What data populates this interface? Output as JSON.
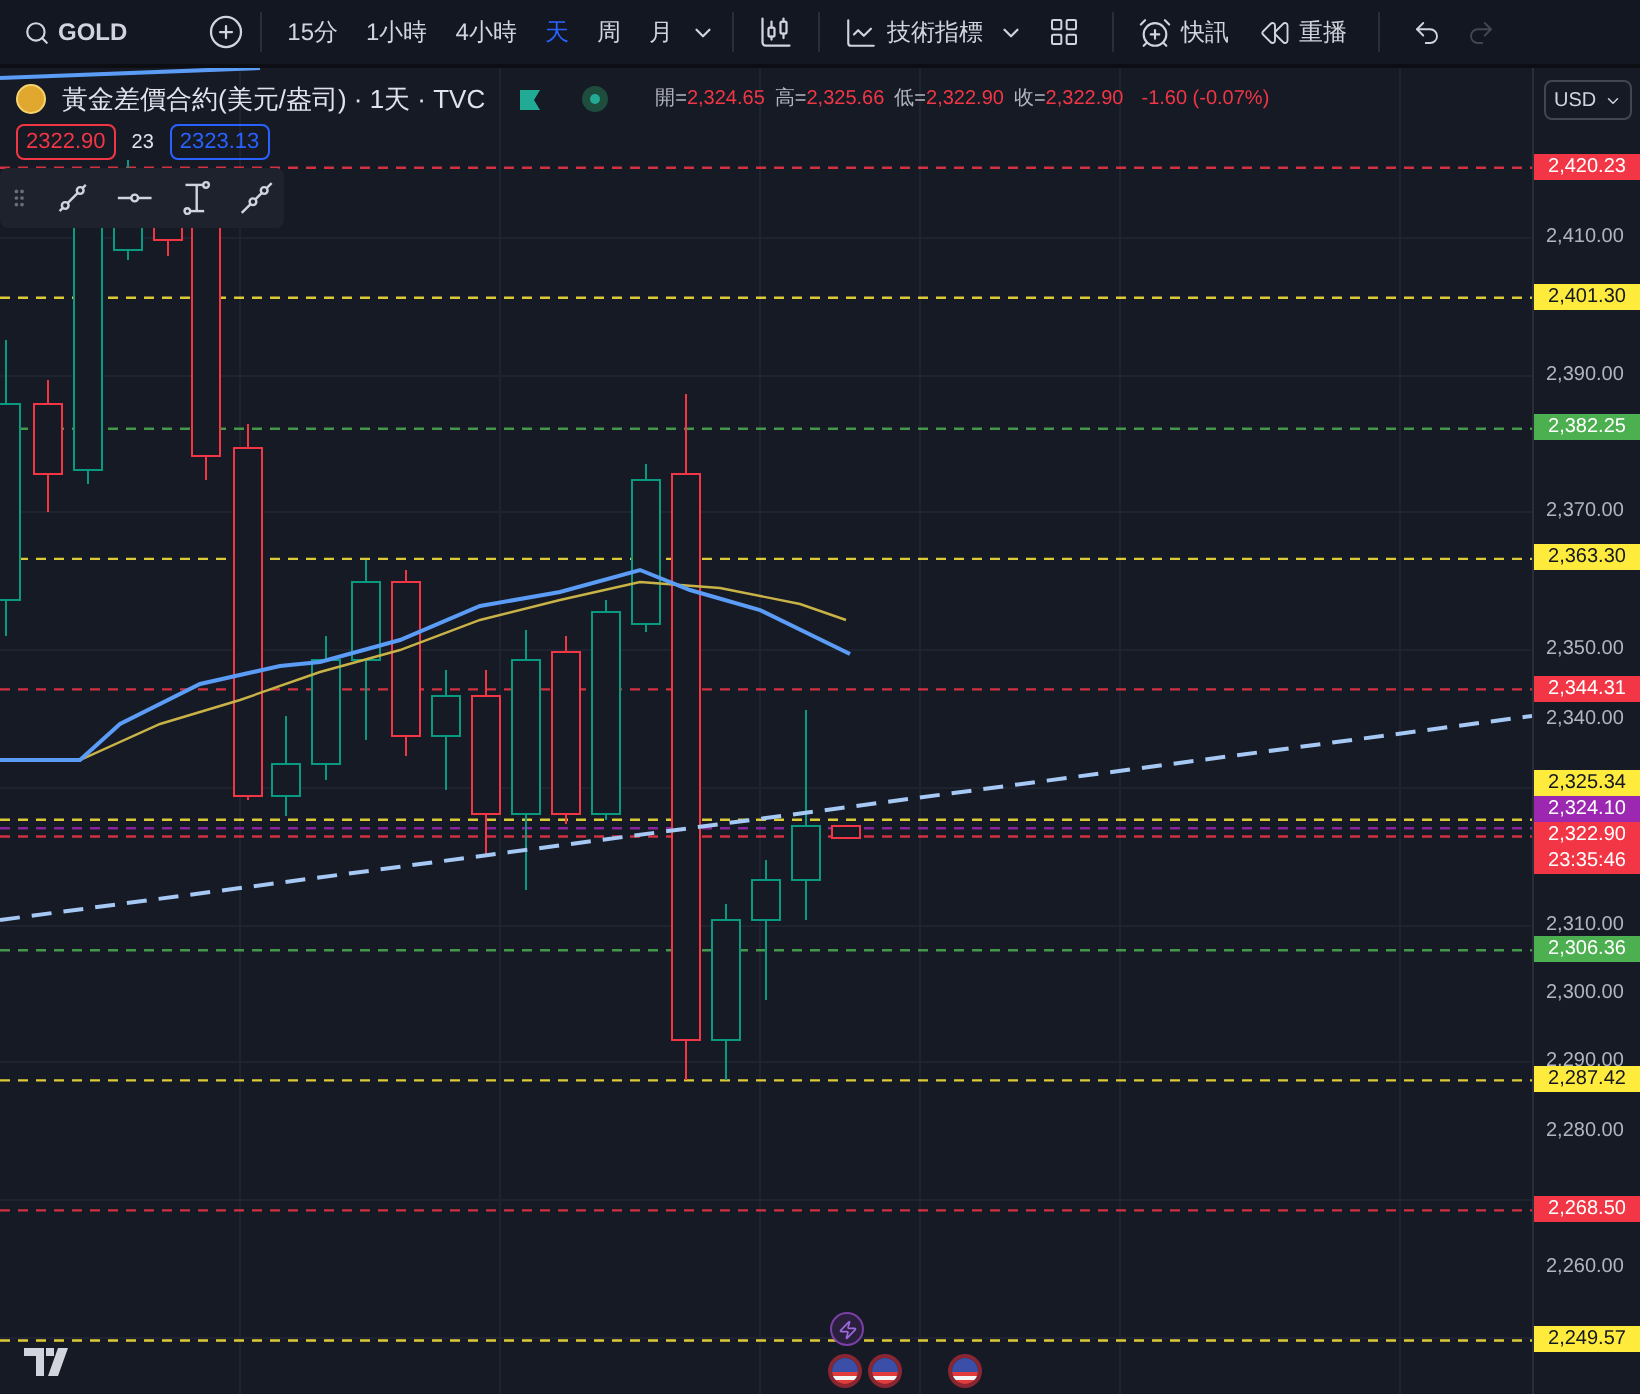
{
  "toolbar": {
    "symbol": "GOLD",
    "intervals": [
      {
        "label": "15分",
        "selected": false
      },
      {
        "label": "1小時",
        "selected": false
      },
      {
        "label": "4小時",
        "selected": false
      },
      {
        "label": "天",
        "selected": true
      },
      {
        "label": "周",
        "selected": false
      },
      {
        "label": "月",
        "selected": false
      }
    ],
    "indicators_button": "技術指標",
    "alert_button": "快訊",
    "replay_button": "重播",
    "redo_disabled": true
  },
  "legend": {
    "title": "黃金差價合約(美元/盎司) · 1天 · TVC",
    "ohlc": [
      {
        "label": "開=",
        "value": "2,324.65"
      },
      {
        "label": "高=",
        "value": "2,325.66"
      },
      {
        "label": "低=",
        "value": "2,322.90"
      },
      {
        "label": "收=",
        "value": "2,322.90"
      }
    ],
    "change": "-1.60 (-0.07%)",
    "sell_price": "2322.90",
    "spread": "23",
    "buy_price": "2323.13"
  },
  "currency": "USD",
  "axis_ticks": [
    "2,410.00",
    "2,390.00",
    "2,370.00",
    "2,350.00",
    "2,340.00",
    "2,310.00",
    "2,300.00",
    "2,290.00",
    "2,280.00",
    "2,260.00"
  ],
  "price_levels": [
    {
      "price": "2,420.23",
      "color": "#f23645"
    },
    {
      "price": "2,401.30",
      "color": "#ffeb3b"
    },
    {
      "price": "2,382.25",
      "color": "#4caf50"
    },
    {
      "price": "2,363.30",
      "color": "#ffeb3b"
    },
    {
      "price": "2,344.31",
      "color": "#f23645"
    },
    {
      "price": "2,325.34",
      "color": "#ffeb3b"
    },
    {
      "price": "2,324.10",
      "color": "#9c27b0"
    },
    {
      "price": "2,322.90",
      "color": "#f23645",
      "countdown": "23:35:46"
    },
    {
      "price": "2,306.36",
      "color": "#4caf50"
    },
    {
      "price": "2,287.42",
      "color": "#ffeb3b"
    },
    {
      "price": "2,268.50",
      "color": "#f23645"
    },
    {
      "price": "2,249.57",
      "color": "#ffeb3b"
    }
  ]
}
